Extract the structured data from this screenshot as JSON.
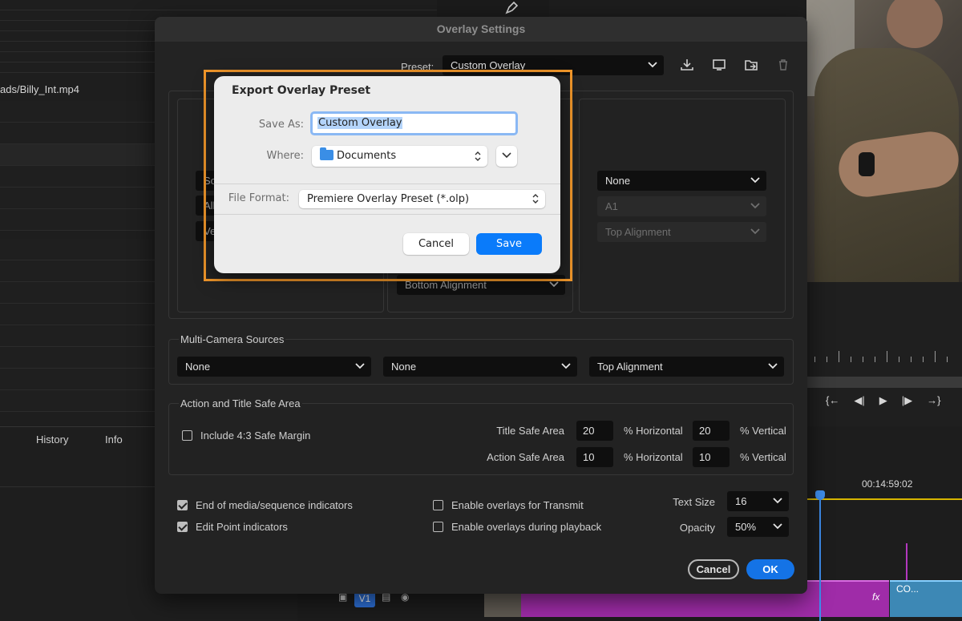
{
  "background": {
    "project_path": "ads/Billy_Int.mp4",
    "tabs": [
      "History",
      "Info"
    ],
    "timecode": "00:14:59:02",
    "track_label": "V1",
    "clip_label": "CO...",
    "fx_label": "fx"
  },
  "overlay_dialog": {
    "title": "Overlay Settings",
    "preset_label": "Preset:",
    "preset_value": "Custom Overlay",
    "column_right": {
      "camera": "None",
      "track": "A1",
      "alignment": "Top Alignment"
    },
    "column_middle": {
      "alignment": "Bottom Alignment"
    },
    "multicam": {
      "label": "Multi-Camera Sources",
      "sources": [
        "None",
        "None",
        "Top Alignment"
      ]
    },
    "safe_area": {
      "label": "Action and Title Safe Area",
      "include_label": "Include 4:3 Safe Margin",
      "include_checked": false,
      "title_label": "Title Safe Area",
      "title_h": "20",
      "title_v": "20",
      "action_label": "Action Safe Area",
      "action_h": "10",
      "action_v": "10",
      "h_unit": "% Horizontal",
      "v_unit": "% Vertical"
    },
    "options": {
      "end_indicators": "End of media/sequence indicators",
      "end_checked": true,
      "edit_point": "Edit Point indicators",
      "edit_checked": true,
      "transmit": "Enable overlays for Transmit",
      "transmit_checked": false,
      "playback": "Enable overlays during playback",
      "playback_checked": false,
      "text_size_label": "Text Size",
      "text_size": "16",
      "opacity_label": "Opacity",
      "opacity": "50%"
    },
    "cancel": "Cancel",
    "ok": "OK"
  },
  "export_sheet": {
    "title": "Export Overlay Preset",
    "save_as_label": "Save As:",
    "save_as_value": "Custom Overlay",
    "where_label": "Where:",
    "where_value": "Documents",
    "format_label": "File Format:",
    "format_value": "Premiere Overlay Preset (*.olp)",
    "cancel": "Cancel",
    "save": "Save"
  },
  "colors": {
    "accent": "#1473e6",
    "highlight": "#f0962a",
    "mac_blue": "#0a7bfa"
  }
}
